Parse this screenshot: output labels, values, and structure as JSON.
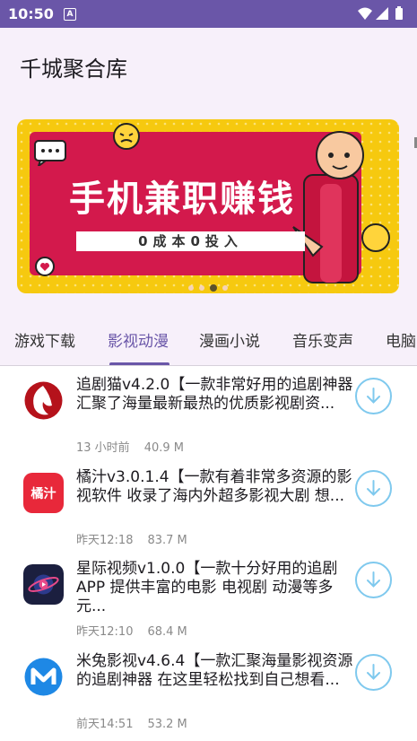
{
  "status_bar": {
    "time": "10:50",
    "notification_letter": "A"
  },
  "app": {
    "title": "千城聚合库"
  },
  "banner": {
    "headline": "手机兼职赚钱",
    "subline": "0成本0投入",
    "dots": 4,
    "active_dot": 2
  },
  "tabs": [
    {
      "label": "游戏下载"
    },
    {
      "label": "影视动漫"
    },
    {
      "label": "漫画小说"
    },
    {
      "label": "音乐变声"
    },
    {
      "label": "电脑"
    }
  ],
  "active_tab": 1,
  "items": [
    {
      "title": "追剧猫v4.2.0【一款非常好用的追剧神器 汇聚了海量最新最热的优质影视剧资...",
      "time": "13 小时前",
      "size": "40.9 M",
      "icon": "zhuijumao-icon",
      "icon_text": ""
    },
    {
      "title": "橘汁v3.0.1.4【一款有着非常多资源的影视软件 收录了海内外超多影视大剧 想...",
      "time": "昨天12:18",
      "size": "83.7 M",
      "icon": "juzhi-icon",
      "icon_text": "橘汁"
    },
    {
      "title": "星际视频v1.0.0【一款十分好用的追剧APP 提供丰富的电影 电视剧 动漫等多元...",
      "time": "昨天12:10",
      "size": "68.4 M",
      "icon": "xingji-icon",
      "icon_text": ""
    },
    {
      "title": "米兔影视v4.6.4【一款汇聚海量影视资源的追剧神器 在这里轻松找到自己想看...",
      "time": "前天14:51",
      "size": "53.2 M",
      "icon": "mitu-icon",
      "icon_text": ""
    }
  ],
  "colors": {
    "primary": "#6a56a8",
    "accent": "#7fc9ee",
    "banner_red": "#d3194c",
    "banner_yellow": "#f6c90f"
  }
}
